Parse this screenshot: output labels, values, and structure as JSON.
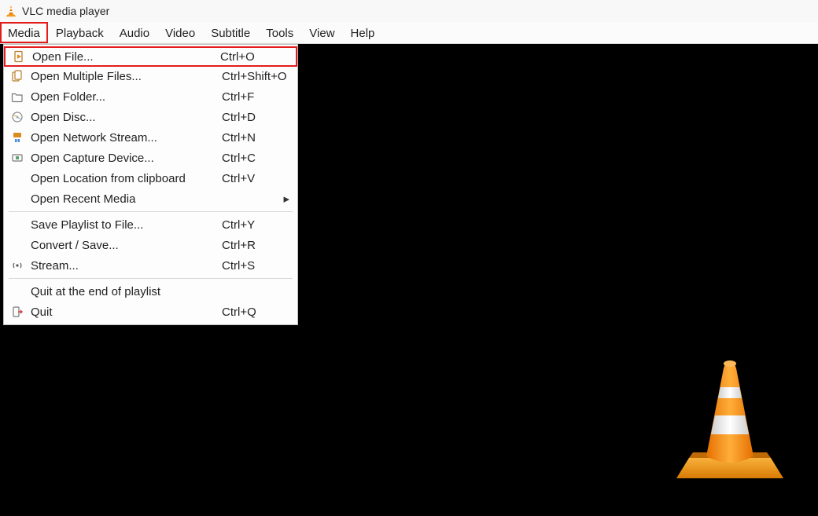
{
  "window": {
    "title": "VLC media player"
  },
  "menubar": {
    "items": [
      "Media",
      "Playback",
      "Audio",
      "Video",
      "Subtitle",
      "Tools",
      "View",
      "Help"
    ],
    "active_index": 0
  },
  "media_menu": {
    "groups": [
      [
        {
          "icon": "file-icon",
          "label": "Open File...",
          "shortcut": "Ctrl+O",
          "highlight": true
        },
        {
          "icon": "files-icon",
          "label": "Open Multiple Files...",
          "shortcut": "Ctrl+Shift+O"
        },
        {
          "icon": "folder-icon",
          "label": "Open Folder...",
          "shortcut": "Ctrl+F"
        },
        {
          "icon": "disc-icon",
          "label": "Open Disc...",
          "shortcut": "Ctrl+D"
        },
        {
          "icon": "network-icon",
          "label": "Open Network Stream...",
          "shortcut": "Ctrl+N"
        },
        {
          "icon": "capture-icon",
          "label": "Open Capture Device...",
          "shortcut": "Ctrl+C"
        },
        {
          "icon": "",
          "label": "Open Location from clipboard",
          "shortcut": "Ctrl+V"
        },
        {
          "icon": "",
          "label": "Open Recent Media",
          "shortcut": "",
          "submenu": true
        }
      ],
      [
        {
          "icon": "",
          "label": "Save Playlist to File...",
          "shortcut": "Ctrl+Y"
        },
        {
          "icon": "",
          "label": "Convert / Save...",
          "shortcut": "Ctrl+R"
        },
        {
          "icon": "stream-icon",
          "label": "Stream...",
          "shortcut": "Ctrl+S"
        }
      ],
      [
        {
          "icon": "",
          "label": "Quit at the end of playlist",
          "shortcut": ""
        },
        {
          "icon": "quit-icon",
          "label": "Quit",
          "shortcut": "Ctrl+Q"
        }
      ]
    ]
  }
}
